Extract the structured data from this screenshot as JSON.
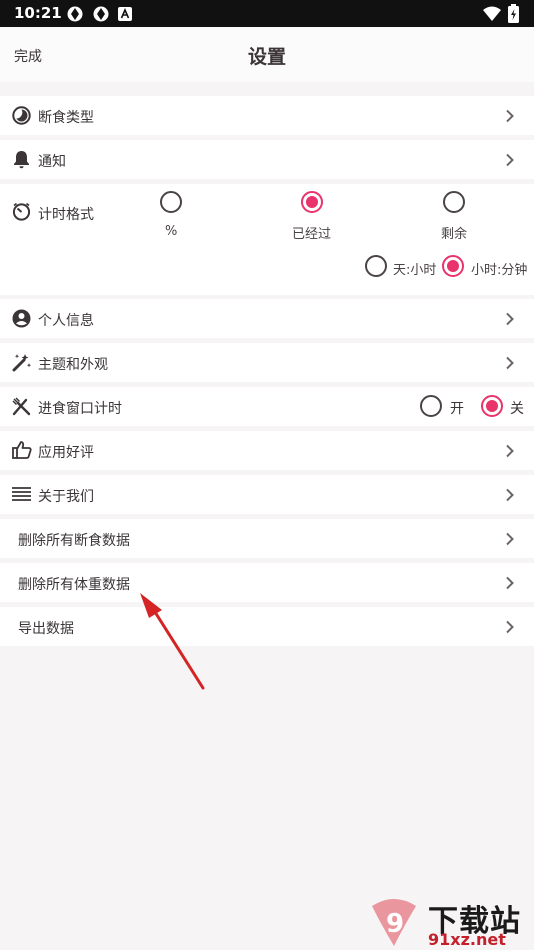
{
  "status_bar": {
    "time": "10:21"
  },
  "header": {
    "done_label": "完成",
    "title": "设置"
  },
  "rows": {
    "fasting_type": "断食类型",
    "notifications": "通知",
    "timer_format": "计时格式",
    "personal_info": "个人信息",
    "theme": "主题和外观",
    "eating_window": "进食窗口计时",
    "rate_app": "应用好评",
    "about": "关于我们",
    "delete_fasting": "删除所有断食数据",
    "delete_weight": "删除所有体重数据",
    "export": "导出数据"
  },
  "timer_format": {
    "options": [
      "%",
      "已经过",
      "剩余"
    ],
    "selected": "已经过",
    "unit_options": [
      "天:小时",
      "小时:分钟"
    ],
    "unit_selected": "小时:分钟"
  },
  "eating_window": {
    "on_label": "开",
    "off_label": "关",
    "selected": "关"
  },
  "watermark": {
    "brand": "下载站",
    "site": "91xz.net",
    "logo_text": "9"
  },
  "colors": {
    "accent": "#e8336b",
    "arrow": "#d42424"
  }
}
